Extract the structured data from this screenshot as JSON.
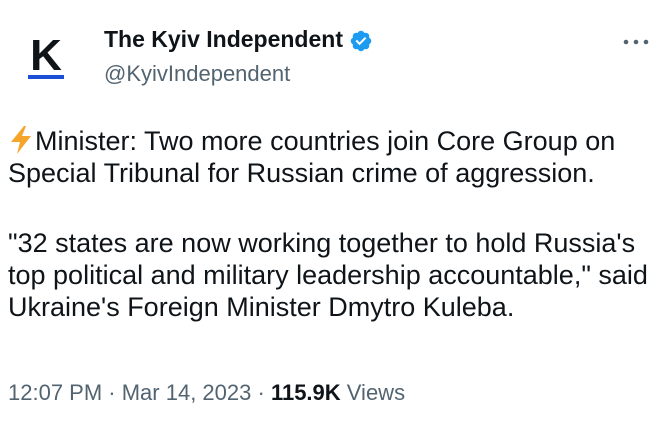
{
  "author": {
    "name": "The Kyiv Independent",
    "handle": "@KyivIndependent",
    "avatar_letter": "K",
    "verified_color": "#1d9bf0",
    "avatar_underline_color": "#1a4fd6"
  },
  "more_icon": "more-horizontal-icon",
  "body": {
    "para1_icon": "lightning-bolt-icon",
    "para1_text": "Minister: Two more countries join Core Group on Special Tribunal for Russian crime of aggression.",
    "para2_text": "\"32 states are now working together to hold Russia's top political and military leadership accountable,\" said Ukraine's Foreign Minister Dmytro Kuleba."
  },
  "meta": {
    "time": "12:07 PM",
    "separator": " · ",
    "date": "Mar 14, 2023",
    "views_count": "115.9K",
    "views_label": " Views"
  }
}
